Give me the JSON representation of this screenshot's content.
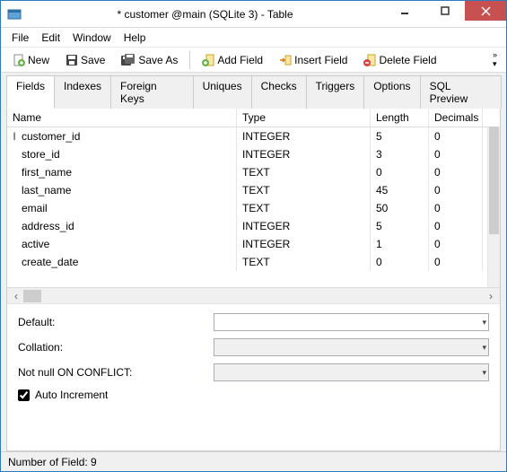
{
  "window": {
    "title": "* customer @main (SQLite 3) - Table"
  },
  "menu": {
    "file": "File",
    "edit": "Edit",
    "window": "Window",
    "help": "Help"
  },
  "toolbar": {
    "new": "New",
    "save": "Save",
    "saveas": "Save As",
    "addfield": "Add Field",
    "insertfield": "Insert Field",
    "deletefield": "Delete Field"
  },
  "tabs": {
    "fields": "Fields",
    "indexes": "Indexes",
    "fkeys": "Foreign Keys",
    "uniques": "Uniques",
    "checks": "Checks",
    "triggers": "Triggers",
    "options": "Options",
    "preview": "SQL Preview"
  },
  "cols": {
    "name": "Name",
    "type": "Type",
    "length": "Length",
    "decimals": "Decimals"
  },
  "rows": [
    {
      "name": "customer_id",
      "type": "INTEGER",
      "length": "5",
      "decimals": "0",
      "editing": true
    },
    {
      "name": "store_id",
      "type": "INTEGER",
      "length": "3",
      "decimals": "0"
    },
    {
      "name": "first_name",
      "type": "TEXT",
      "length": "0",
      "decimals": "0"
    },
    {
      "name": "last_name",
      "type": "TEXT",
      "length": "45",
      "decimals": "0"
    },
    {
      "name": "email",
      "type": "TEXT",
      "length": "50",
      "decimals": "0"
    },
    {
      "name": "address_id",
      "type": "INTEGER",
      "length": "5",
      "decimals": "0"
    },
    {
      "name": "active",
      "type": "INTEGER",
      "length": "1",
      "decimals": "0"
    },
    {
      "name": "create_date",
      "type": "TEXT",
      "length": "0",
      "decimals": "0"
    }
  ],
  "form": {
    "default": "Default:",
    "collation": "Collation:",
    "conflict": "Not null ON CONFLICT:",
    "autoinc": "Auto Increment",
    "autoinc_checked": true
  },
  "status": {
    "text": "Number of Field: 9"
  },
  "icons": {}
}
